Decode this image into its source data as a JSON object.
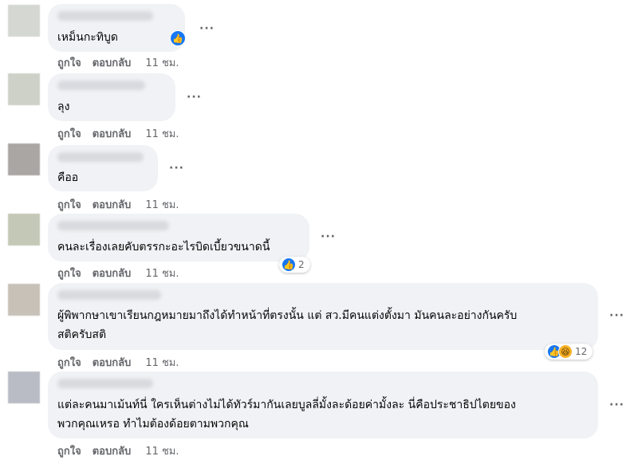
{
  "action_like": "ถูกใจ",
  "action_reply": "ตอบกลับ",
  "more": "···",
  "comments": [
    {
      "text": "เหม็นกะทิบูด",
      "time": "11 ชม."
    },
    {
      "text": "ลุง",
      "time": "11 ชม."
    },
    {
      "text": "คืออ",
      "time": "11 ชม."
    },
    {
      "text": "คนละเรื่องเลยคับตรรกะอะไรบิดเบี้ยวขนาดนี้",
      "time": "11 ชม.",
      "reaction_count": "2"
    },
    {
      "text": "ผู้พิพากษาเขาเรียนกฎหมายมาถึงได้ทำหน้าที่ตรงนั้น แต่ สว.มีคนแต่งตั้งมา มันคนละอย่างกันครับ\nสติครับสติ",
      "time": "11 ชม.",
      "reaction_count": "12"
    },
    {
      "text": "แต่ละคนมาเม้นท์นี่ ใครเห็นต่างไม่ได้ทัวร์มากันเลยบูลลี่มั้งละด้อยค่ามั้งละ นี่คือประชาธิปไตยของ\nพวกคุณเหรอ ทำไมต้องด้อยตามพวกคุณ",
      "time": "11 ชม."
    }
  ],
  "icons": {
    "like": "thumbs-up-icon",
    "haha": "haha-icon"
  },
  "colors": {
    "bubble": "#f0f2f5",
    "meta": "#65676b",
    "like_blue": "#1877f2"
  }
}
